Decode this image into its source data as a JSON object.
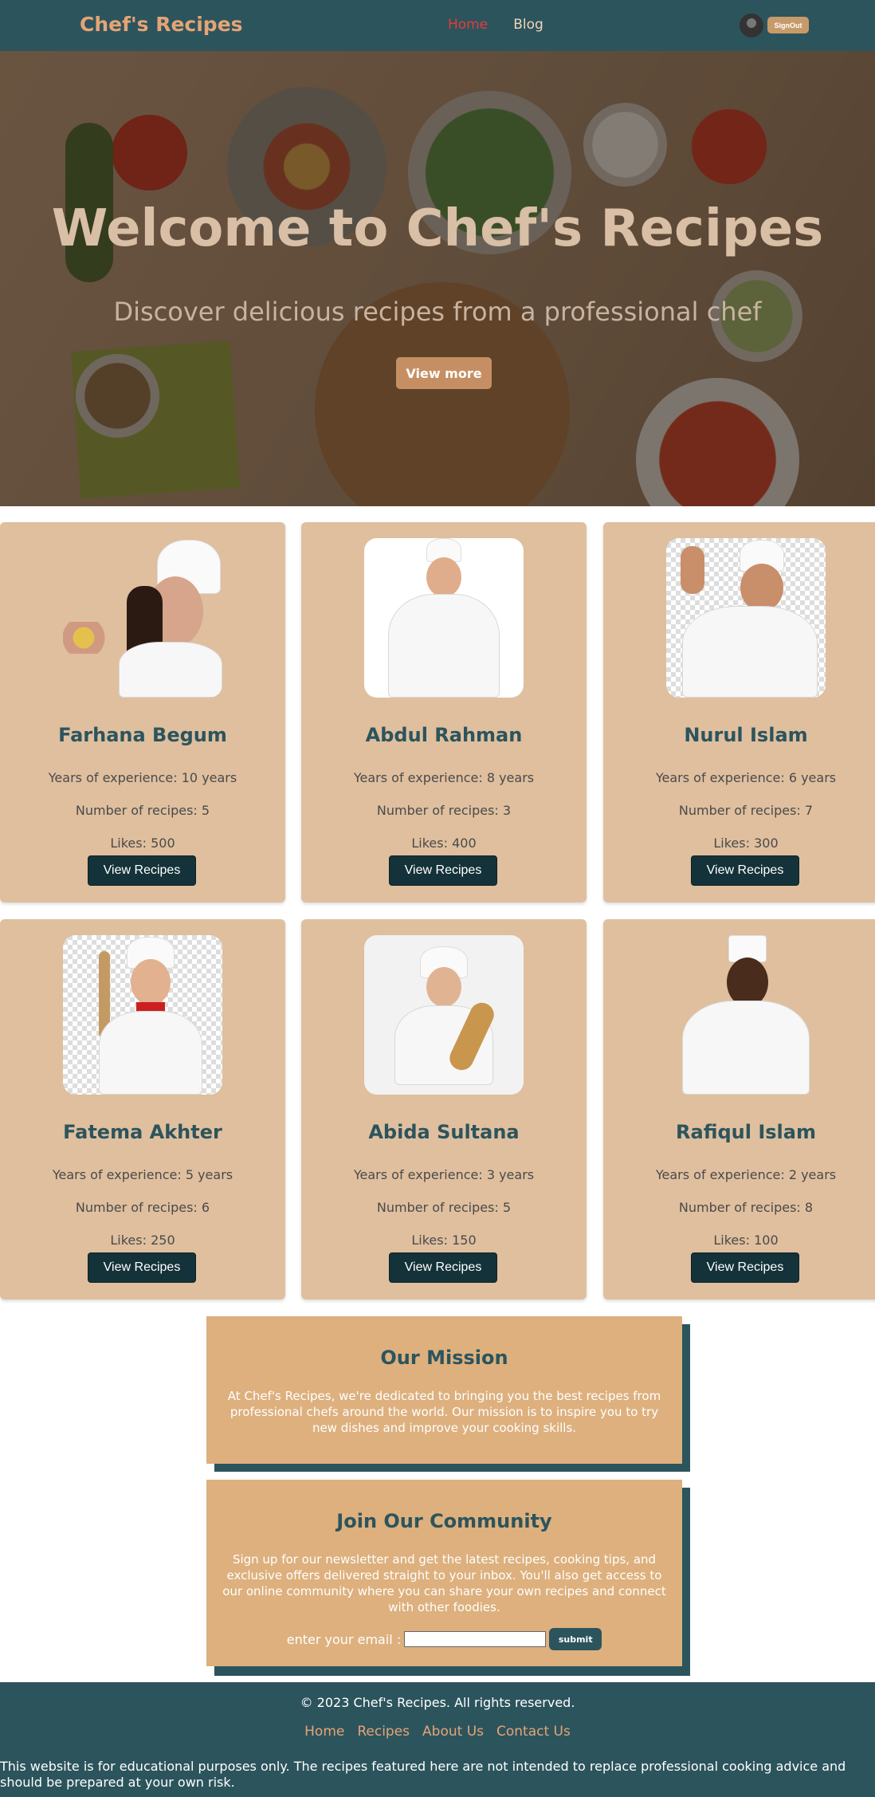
{
  "nav": {
    "brand": "Chef's Recipes",
    "links": [
      "Home",
      "Blog"
    ],
    "signout_label": "SignOut"
  },
  "hero": {
    "title": "Welcome to Chef's Recipes",
    "subtitle": "Discover delicious recipes from a professional chef",
    "button_label": "View more"
  },
  "chefs": [
    {
      "name": "Farhana Begum",
      "experience": "Years of experience: 10 years",
      "recipes": "Number of recipes: 5",
      "likes": "Likes: 500",
      "button": "View Recipes"
    },
    {
      "name": "Abdul Rahman",
      "experience": "Years of experience: 8 years",
      "recipes": "Number of recipes: 3",
      "likes": "Likes: 400",
      "button": "View Recipes"
    },
    {
      "name": "Nurul Islam",
      "experience": "Years of experience: 6 years",
      "recipes": "Number of recipes: 7",
      "likes": "Likes: 300",
      "button": "View Recipes"
    },
    {
      "name": "Fatema Akhter",
      "experience": "Years of experience: 5 years",
      "recipes": "Number of recipes: 6",
      "likes": "Likes: 250",
      "button": "View Recipes"
    },
    {
      "name": "Abida Sultana",
      "experience": "Years of experience: 3 years",
      "recipes": "Number of recipes: 5",
      "likes": "Likes: 150",
      "button": "View Recipes"
    },
    {
      "name": "Rafiqul Islam",
      "experience": "Years of experience: 2 years",
      "recipes": "Number of recipes: 8",
      "likes": "Likes: 100",
      "button": "View Recipes"
    }
  ],
  "mission": {
    "title": "Our Mission",
    "text": "At Chef's Recipes, we're dedicated to bringing you the best recipes from professional chefs around the world. Our mission is to inspire you to try new dishes and improve your cooking skills."
  },
  "community": {
    "title": "Join Our Community",
    "text": "Sign up for our newsletter and get the latest recipes, cooking tips, and exclusive offers delivered straight to your inbox. You'll also get access to our online community where you can share your own recipes and connect with other foodies.",
    "email_label": "enter your email :",
    "email_value": "",
    "submit_label": "submit"
  },
  "footer": {
    "copyright": "© 2023 Chef's Recipes. All rights reserved.",
    "links": [
      "Home",
      "Recipes",
      "About Us",
      "Contact Us"
    ],
    "disclaimer": "This website is for educational purposes only. The recipes featured here are not intended to replace professional cooking advice and should be prepared at your own risk."
  },
  "colors": {
    "primary": "#2c545d",
    "accent": "#e5a476",
    "card": "#dfbf9e",
    "button_dark": "#143239"
  }
}
